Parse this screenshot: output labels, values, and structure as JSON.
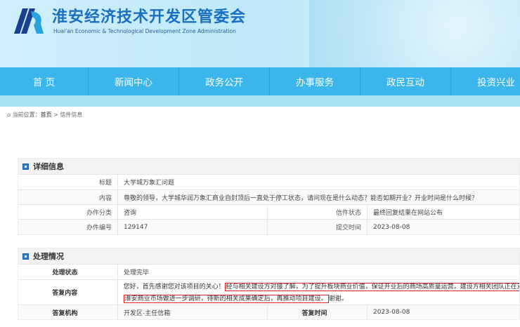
{
  "header": {
    "title": "淮安经济技术开发区管委会",
    "subtitle": "Huai'an Economic & Technological Development Zone Administration"
  },
  "nav": [
    "首 页",
    "新闻中心",
    "政务公开",
    "办事服务",
    "政民互动",
    "投资兴业"
  ],
  "breadcrumb": {
    "prefix": "当前位置：",
    "home": "首页",
    "sep": " > ",
    "current": "信件信息"
  },
  "detail": {
    "heading": "详细信息",
    "title_label": "标题",
    "title": "大学城万象汇问题",
    "content_label": "内容",
    "content": "尊敬的领导，大学城华润万象汇商业自封顶后一直处于停工状态，请问现在是什么动态？能否如期开业？开业时间是什么时候？",
    "category_label": "办件分类",
    "category": "咨询",
    "status_label": "信件状态",
    "status": "最终回复结果在网站公布",
    "number_label": "办件编号",
    "number": "129147",
    "submit_label": "提交时间",
    "submit_time": "2023-08-08"
  },
  "handling": {
    "heading": "处理情况",
    "state_label": "处理状态",
    "state": "处理完毕",
    "reply_label": "答复内容",
    "reply_a": "您好，首先感谢您对该项目的关心！",
    "reply_b": "经与相关建设方对接了解，为了提升板块商业价值，保证开业后的商场高质量运营，建设方相关团队正在对",
    "reply_c": "淮安商业市场做进一步调研，待新的相关成果确定后，再推动项目建设。",
    "reply_d": "谢谢。",
    "org_label": "答复机构",
    "org": "开发区-主任信箱",
    "time_label": "答复时间",
    "time": "2023-08-08"
  },
  "colors": {
    "nav": "#3bb6ec",
    "highlight": "#e02020"
  }
}
